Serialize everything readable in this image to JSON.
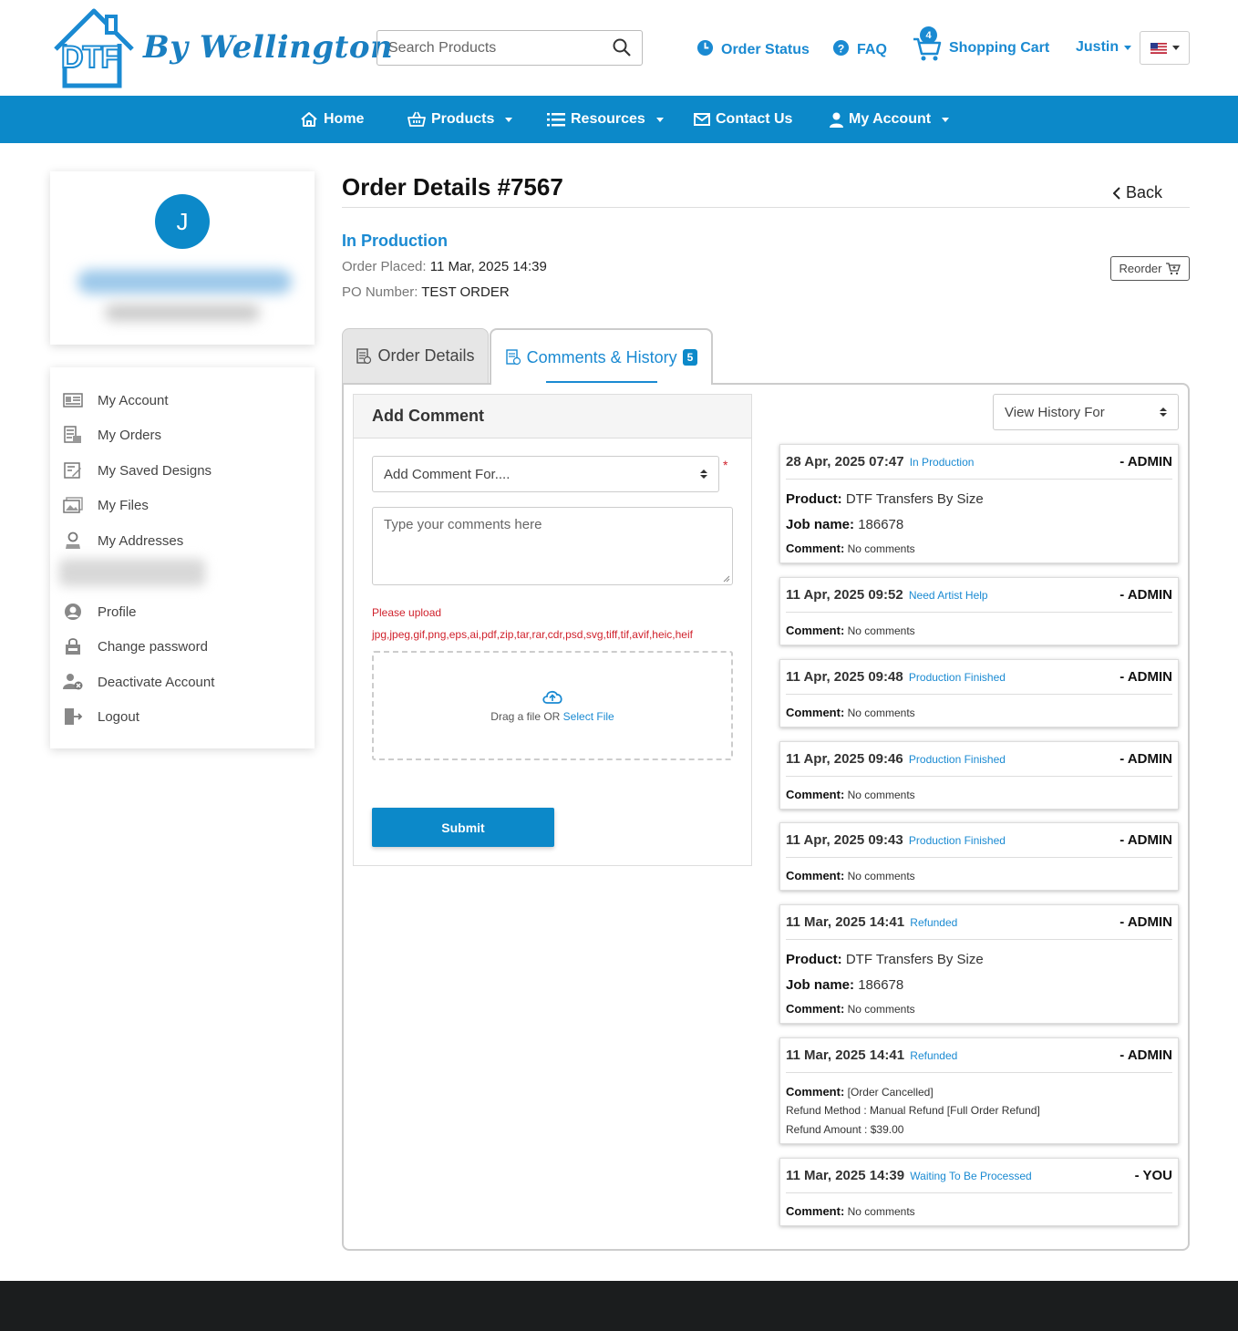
{
  "header": {
    "logo_text": "DTF",
    "logo_script": "By Wellington",
    "search_placeholder": "Search Products",
    "order_status": "Order Status",
    "faq": "FAQ",
    "cart_label": "Shopping Cart",
    "cart_count": "4",
    "user_name": "Justin",
    "flag": "us-flag-icon"
  },
  "nav": {
    "home": "Home",
    "products": "Products",
    "resources": "Resources",
    "contact": "Contact Us",
    "account": "My Account"
  },
  "sidebar": {
    "avatar_initial": "J",
    "items": [
      {
        "label": "My Account",
        "icon": "account-card-icon"
      },
      {
        "label": "My Orders",
        "icon": "orders-icon"
      },
      {
        "label": "My Saved Designs",
        "icon": "designs-icon"
      },
      {
        "label": "My Files",
        "icon": "files-icon"
      },
      {
        "label": "My Addresses",
        "icon": "address-icon"
      },
      {
        "label": "Profile",
        "icon": "profile-icon"
      },
      {
        "label": "Change password",
        "icon": "lock-icon"
      },
      {
        "label": "Deactivate Account",
        "icon": "deactivate-icon"
      },
      {
        "label": "Logout",
        "icon": "logout-icon"
      }
    ]
  },
  "order": {
    "title": "Order Details #7567",
    "back": "Back",
    "status": "In Production",
    "placed_label": "Order Placed:",
    "placed_value": "11 Mar, 2025 14:39",
    "po_label": "PO Number:",
    "po_value": "TEST ORDER",
    "reorder": "Reorder"
  },
  "tabs": {
    "details": "Order Details",
    "comments": "Comments & History",
    "comments_count": "5"
  },
  "add_comment": {
    "heading": "Add Comment",
    "for_placeholder": "Add Comment For....",
    "required_mark": "*",
    "textarea_placeholder": "Type your comments here",
    "upload_note_1": "Please upload",
    "upload_note_2": "jpg,jpeg,gif,png,eps,ai,pdf,zip,tar,rar,cdr,psd,svg,tiff,tif,avif,heic,heif",
    "drag_text": "Drag a file OR",
    "select_file": "Select File",
    "submit": "Submit"
  },
  "history": {
    "view_for": "View History For",
    "product_label": "Product:",
    "job_label": "Job name:",
    "comment_label": "Comment:",
    "entries": [
      {
        "date": "28 Apr, 2025 07:47",
        "status": "In Production",
        "who": "- ADMIN",
        "product": "DTF Transfers By Size",
        "job": "186678",
        "comment": "No comments"
      },
      {
        "date": "11 Apr, 2025 09:52",
        "status": "Need Artist Help",
        "who": "- ADMIN",
        "comment": "No comments"
      },
      {
        "date": "11 Apr, 2025 09:48",
        "status": "Production Finished",
        "who": "- ADMIN",
        "comment": "No comments"
      },
      {
        "date": "11 Apr, 2025 09:46",
        "status": "Production Finished",
        "who": "- ADMIN",
        "comment": "No comments"
      },
      {
        "date": "11 Apr, 2025 09:43",
        "status": "Production Finished",
        "who": "- ADMIN",
        "comment": "No comments"
      },
      {
        "date": "11 Mar, 2025 14:41",
        "status": "Refunded",
        "who": "- ADMIN",
        "product": "DTF Transfers By Size",
        "job": "186678",
        "comment": "No comments"
      },
      {
        "date": "11 Mar, 2025 14:41",
        "status": "Refunded",
        "who": "- ADMIN",
        "comment": "[Order Cancelled]",
        "extra_1": "Refund Method : Manual Refund [Full Order Refund]",
        "extra_2": "Refund Amount : $39.00"
      },
      {
        "date": "11 Mar, 2025 14:39",
        "status": "Waiting To Be Processed",
        "who": "- YOU",
        "comment": "No comments"
      }
    ]
  },
  "colors": {
    "brand_blue": "#0c89c9",
    "link_blue": "#1a8ad2",
    "error_red": "#d0222d",
    "footer": "#1b1d1e"
  }
}
